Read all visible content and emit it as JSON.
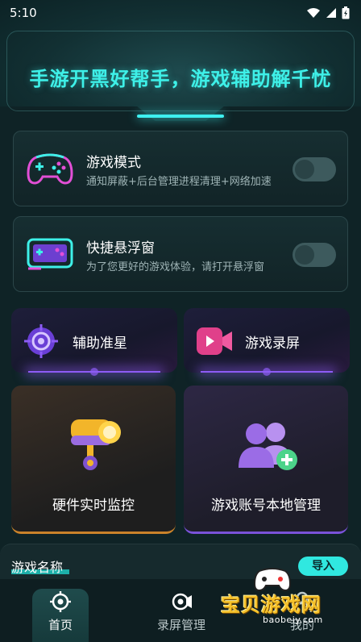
{
  "status_bar": {
    "time": "5:10"
  },
  "banner": {
    "title": "手游开黑好帮手，游戏辅助解千忧"
  },
  "cards": [
    {
      "title": "游戏模式",
      "desc": "通知屏蔽+后台管理进程清理+网络加速",
      "icon": "gamepad-icon",
      "toggle_on": false
    },
    {
      "title": "快捷悬浮窗",
      "desc": "为了您更好的游戏体验，请打开悬浮窗",
      "icon": "floating-window-icon",
      "toggle_on": false
    }
  ],
  "tiles": [
    {
      "label": "辅助准星",
      "icon": "crosshair-icon"
    },
    {
      "label": "游戏录屏",
      "icon": "video-camera-icon"
    }
  ],
  "big_tiles": [
    {
      "label": "硬件实时监控",
      "icon": "surveillance-camera-icon"
    },
    {
      "label": "游戏账号本地管理",
      "icon": "add-users-icon"
    }
  ],
  "section": {
    "title": "游戏名称",
    "import_label": "导入"
  },
  "tabs": [
    {
      "label": "首页",
      "icon": "home-target-icon",
      "active": true
    },
    {
      "label": "录屏管理",
      "icon": "record-icon",
      "active": false
    },
    {
      "label": "我的",
      "icon": "profile-icon",
      "active": false
    }
  ],
  "watermark": {
    "text": "宝贝游戏网",
    "url": "baobeiy.com"
  },
  "colors": {
    "accent": "#3ef0e8",
    "purple": "#8d5cf5",
    "orange": "#c9822a"
  }
}
